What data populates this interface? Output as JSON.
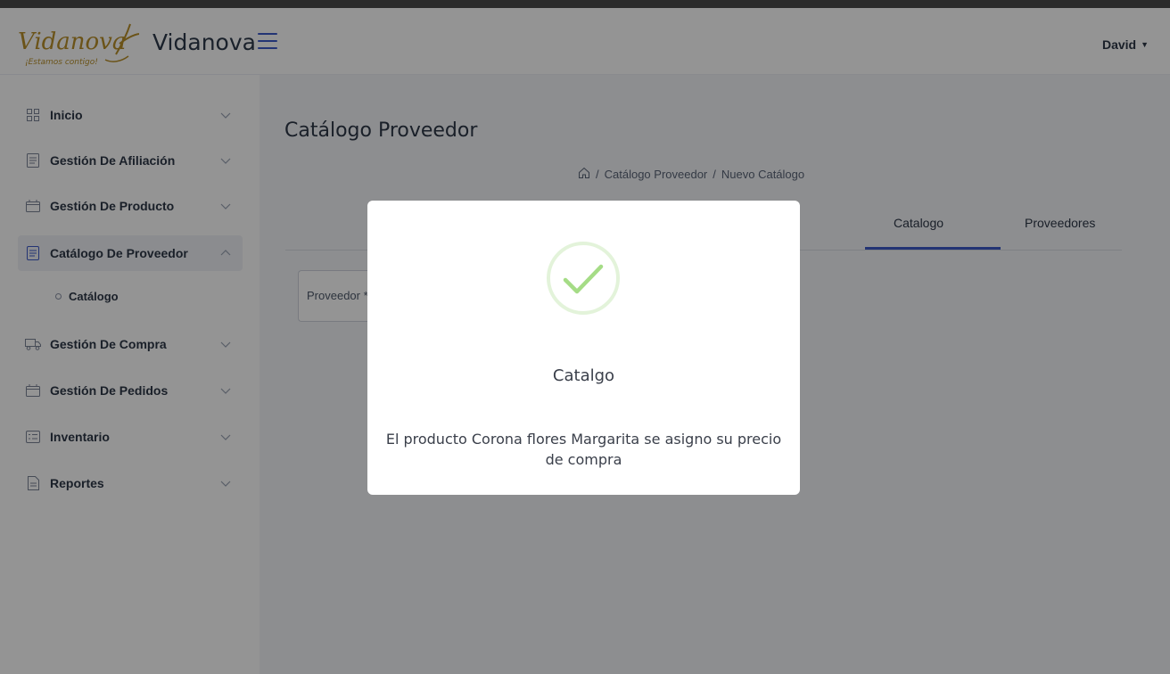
{
  "header": {
    "logo_text": "Vidanova",
    "logo_tagline": "¡Estamos contigo!",
    "brand_name": "Vidanova",
    "user_name": "David"
  },
  "sidebar": {
    "items": [
      {
        "label": "Inicio",
        "icon": "grid-icon"
      },
      {
        "label": "Gestión De Afiliación",
        "icon": "document-list-icon"
      },
      {
        "label": "Gestión De Producto",
        "icon": "calendar-box-icon"
      },
      {
        "label": "Catálogo De Proveedor",
        "icon": "document-icon",
        "expanded": true
      },
      {
        "label": "Gestión De Compra",
        "icon": "truck-icon"
      },
      {
        "label": "Gestión De Pedidos",
        "icon": "calendar-box-icon"
      },
      {
        "label": "Inventario",
        "icon": "list-icon"
      },
      {
        "label": "Reportes",
        "icon": "file-icon"
      }
    ],
    "subitems": [
      {
        "label": "Catálogo"
      }
    ]
  },
  "main": {
    "page_title": "Catálogo Proveedor",
    "breadcrumb": [
      "Catálogo Proveedor",
      "Nuevo Catálogo"
    ],
    "tabs": [
      {
        "label": "Catalogo",
        "active": true
      },
      {
        "label": "Proveedores",
        "active": false
      }
    ],
    "provider_field_label": "Proveedor *"
  },
  "modal": {
    "title": "Catalgo",
    "message": "El producto Corona flores Margarita se asigno su precio de compra"
  },
  "colors": {
    "accent": "#3d5ac8",
    "success": "#a5dc86",
    "logo_gold": "#b8902a"
  }
}
